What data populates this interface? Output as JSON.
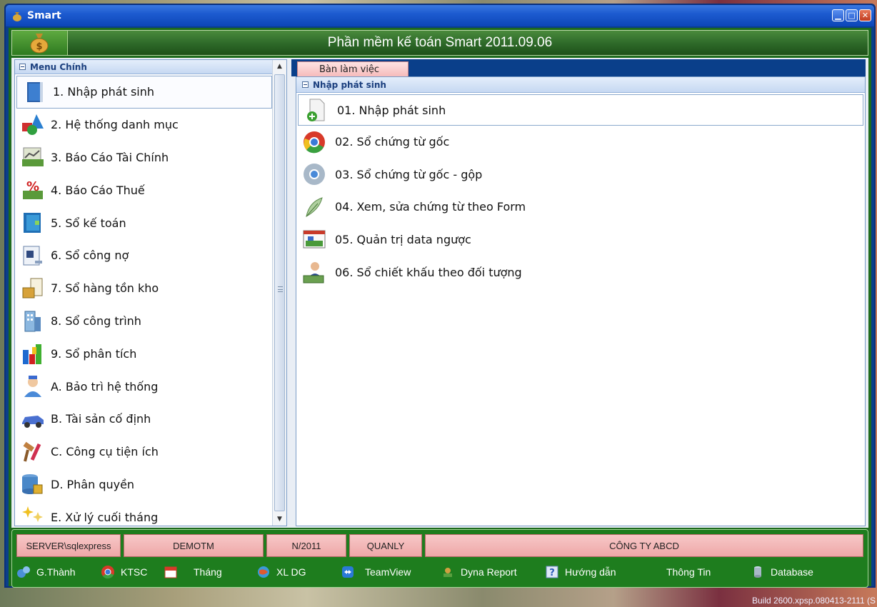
{
  "window": {
    "title": "Smart",
    "controls": [
      "minimize",
      "restore",
      "close"
    ]
  },
  "banner": {
    "title": "Phần mềm kế toán Smart 2011.09.06"
  },
  "left_panel": {
    "header": "Menu Chính",
    "items": [
      {
        "label": "1. Nhập phát sinh",
        "icon": "book-icon"
      },
      {
        "label": "2. Hệ thống danh mục",
        "icon": "shapes-icon"
      },
      {
        "label": "3. Báo Cáo Tài Chính",
        "icon": "chart-money-icon"
      },
      {
        "label": "4. Báo Cáo Thuế",
        "icon": "percent-icon"
      },
      {
        "label": "5. Sổ kế toán",
        "icon": "ledger-icon"
      },
      {
        "label": "6. Sổ công nợ",
        "icon": "card-icon"
      },
      {
        "label": "7. Sổ hàng tồn kho",
        "icon": "clipboard-box-icon"
      },
      {
        "label": "8. Sổ công trình",
        "icon": "building-icon"
      },
      {
        "label": "9. Sổ phân tích",
        "icon": "bar-chart-icon"
      },
      {
        "label": "A. Bảo trì hệ thống",
        "icon": "doctor-icon"
      },
      {
        "label": "B. Tài sản cố định",
        "icon": "car-icon"
      },
      {
        "label": "C. Công cụ tiện ích",
        "icon": "tools-icon"
      },
      {
        "label": "D. Phân quyền",
        "icon": "database-lock-icon"
      },
      {
        "label": "E. Xử lý cuối tháng",
        "icon": "sparkle-icon"
      }
    ]
  },
  "right_panel": {
    "tab": "Bàn làm việc",
    "header": "Nhập phát sinh",
    "items": [
      {
        "label": "01. Nhập phát sinh",
        "icon": "document-add-icon"
      },
      {
        "label": "02. Sổ chứng từ gốc",
        "icon": "chrome-icon"
      },
      {
        "label": "03. Sổ chứng từ gốc - gộp",
        "icon": "chrome-gray-icon"
      },
      {
        "label": "04. Xem, sửa chứng từ  theo Form",
        "icon": "feather-icon"
      },
      {
        "label": "05. Quản trị data ngược",
        "icon": "presentation-icon"
      },
      {
        "label": "06. Sổ chiết khấu theo đối tượng",
        "icon": "person-money-icon"
      }
    ]
  },
  "status": {
    "server": "SERVER\\sqlexpress",
    "database": "DEMOTM",
    "period": "N/2011",
    "user": "QUANLY",
    "company": "CÔNG TY ABCD"
  },
  "toolbar": [
    {
      "label": "G.Thành",
      "icon": "gears-icon"
    },
    {
      "label": "KTSC",
      "icon": "chrome-small-icon"
    },
    {
      "label": "Tháng",
      "icon": "calendar-icon"
    },
    {
      "label": "XL DG",
      "icon": "globe-icon"
    },
    {
      "label": "TeamView",
      "icon": "teamviewer-icon"
    },
    {
      "label": "Dyna Report",
      "icon": "report-icon"
    },
    {
      "label": "Hướng dẫn",
      "icon": "help-icon"
    },
    {
      "label": "Thông Tin",
      "icon": ""
    },
    {
      "label": "Database",
      "icon": "database-icon"
    }
  ],
  "build": "Build 2600.xpsp.080413-2111 (S"
}
